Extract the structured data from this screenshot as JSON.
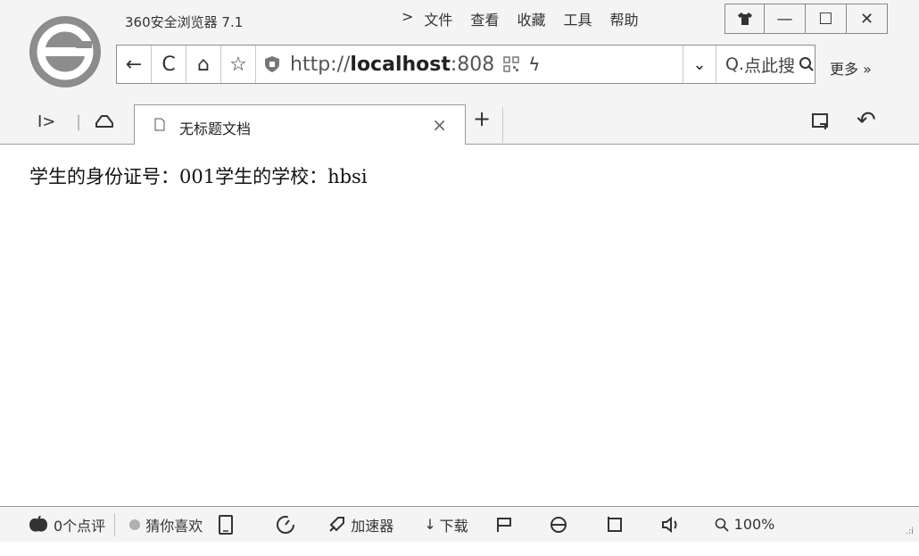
{
  "window": {
    "app_title": "360安全浏览器 7.1",
    "menu": {
      "arrow": ">",
      "items": [
        "文件",
        "查看",
        "收藏",
        "工具",
        "帮助"
      ]
    },
    "controls": {
      "skin": "skin-icon",
      "minimize": "—",
      "maximize": "☐",
      "close": "✕"
    }
  },
  "toolbar": {
    "back": "←",
    "refresh": "C",
    "home": "⌂",
    "favorite": "☆",
    "url_prefix": "http://",
    "url_host": "localhost",
    "url_suffix": ":808",
    "bolt": "ϟ",
    "dropdown": "⌄",
    "search_prefix": "Q.",
    "search_placeholder": "点此搜",
    "search_icon": "search-icon",
    "more": "更多 »"
  },
  "tabs": {
    "sidebar_toggle": "I>",
    "cloud": "cloud-icon",
    "active": {
      "title": "无标题文档",
      "close": "×"
    },
    "new_tab": "+",
    "restore": "restore-icon",
    "undo": "↶"
  },
  "content": {
    "text": "学生的身份证号：001学生的学校：hbsi"
  },
  "statusbar": {
    "review": "0个点评",
    "guess": "猜你喜欢",
    "accelerator": "加速器",
    "download": "下载",
    "zoom": "100%"
  }
}
